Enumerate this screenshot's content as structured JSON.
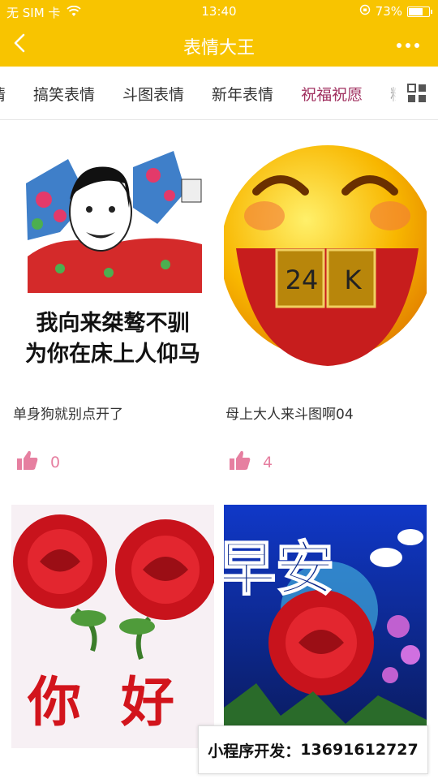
{
  "status_bar": {
    "carrier": "无 SIM 卡",
    "time": "13:40",
    "battery_percent": "73%",
    "battery_level": 0.73
  },
  "nav": {
    "title": "表情大王",
    "back_icon": "chevron-left-icon",
    "more_icon": "more-dots-icon"
  },
  "tabs": {
    "items": [
      "情",
      "搞笑表情",
      "斗图表情",
      "新年表情",
      "祝福祝愿",
      "糙"
    ],
    "active_index": 4,
    "grid_icon": "grid-view-icon"
  },
  "cards": [
    {
      "image_text": [
        "我向来桀骜不驯",
        "为你在床上人仰马"
      ],
      "caption": "单身狗就别点开了",
      "likes": "0"
    },
    {
      "image_text": [
        "24",
        "K"
      ],
      "caption": "母上大人来斗图啊04",
      "likes": "4"
    },
    {
      "image_text": [
        "你",
        "好"
      ],
      "caption": "",
      "likes": ""
    },
    {
      "image_text": [
        "早安"
      ],
      "caption": "",
      "likes": ""
    }
  ],
  "promo": {
    "label": "小程序开发：",
    "phone": "13691612727"
  },
  "colors": {
    "accent": "#f8c400",
    "active_tab": "#a0305f",
    "like": "#e67fa0"
  }
}
